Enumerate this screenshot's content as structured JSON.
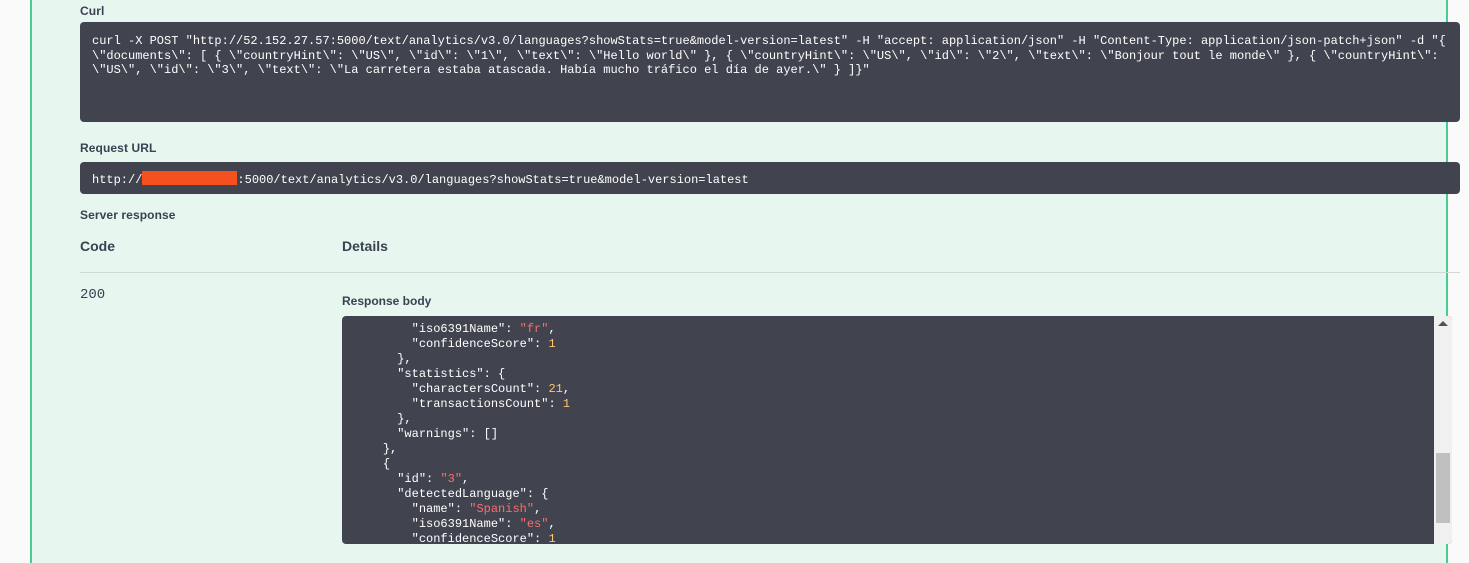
{
  "panel": {
    "accent_color": "#49cc90",
    "background_color": "#e8f6f0",
    "code_background_color": "#41444e",
    "redaction_color": "#f4511e"
  },
  "curl": {
    "label": "Curl",
    "command": "curl -X POST \"http://52.152.27.57:5000/text/analytics/v3.0/languages?showStats=true&model-version=latest\" -H \"accept: application/json\" -H \"Content-Type: application/json-patch+json\" -d \"{ \\\"documents\\\": [ { \\\"countryHint\\\": \\\"US\\\", \\\"id\\\": \\\"1\\\", \\\"text\\\": \\\"Hello world\\\" }, { \\\"countryHint\\\": \\\"US\\\", \\\"id\\\": \\\"2\\\", \\\"text\\\": \\\"Bonjour tout le monde\\\" }, { \\\"countryHint\\\": \\\"US\\\", \\\"id\\\": \\\"3\\\", \\\"text\\\": \\\"La carretera estaba atascada. Había mucho tráfico el día de ayer.\\\" } ]}\""
  },
  "request_url": {
    "label": "Request URL",
    "prefix": "http://",
    "redacted_host": "",
    "suffix": ":5000/text/analytics/v3.0/languages?showStats=true&model-version=latest"
  },
  "server_response": {
    "label": "Server response",
    "columns": {
      "code": "Code",
      "details": "Details"
    },
    "rows": [
      {
        "code": "200",
        "details_label": "Response body"
      }
    ]
  },
  "response_body": {
    "lines": [
      "        \"iso6391Name\": \"fr\",",
      "        \"confidenceScore\": 1",
      "      },",
      "      \"statistics\": {",
      "        \"charactersCount\": 21,",
      "        \"transactionsCount\": 1",
      "      },",
      "      \"warnings\": []",
      "    },",
      "    {",
      "      \"id\": \"3\",",
      "      \"detectedLanguage\": {",
      "        \"name\": \"Spanish\",",
      "        \"iso6391Name\": \"es\",",
      "        \"confidenceScore\": 1"
    ],
    "scrollbar": {
      "up_arrow_icon": "chevron-up-icon",
      "thumb_position_percent": 87
    }
  }
}
